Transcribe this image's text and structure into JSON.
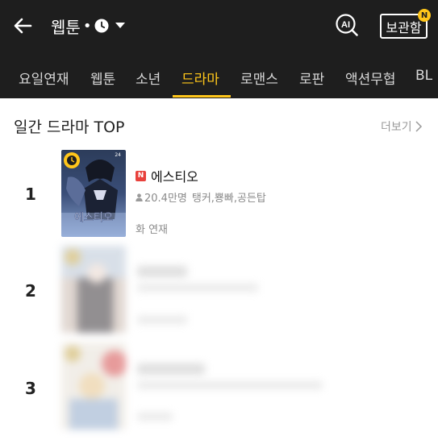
{
  "header": {
    "title": "웹툰",
    "separator": "•",
    "box_label": "보관함",
    "box_badge": "N",
    "ai_label": "AI"
  },
  "tabs": [
    {
      "label": "요일연재",
      "active": false
    },
    {
      "label": "웹툰",
      "active": false
    },
    {
      "label": "소년",
      "active": false
    },
    {
      "label": "드라마",
      "active": true
    },
    {
      "label": "로맨스",
      "active": false
    },
    {
      "label": "로판",
      "active": false
    },
    {
      "label": "액션무협",
      "active": false
    },
    {
      "label": "BL",
      "active": false
    }
  ],
  "section": {
    "title": "일간 드라마 TOP",
    "more_label": "더보기"
  },
  "rankings": [
    {
      "rank": "1",
      "title": "에스티오",
      "badge": "N",
      "views": "20.4만명",
      "authors": "탱커,뿅빠,공든탑",
      "schedule": "화 연재"
    },
    {
      "rank": "2",
      "title": "",
      "views": "",
      "authors": "",
      "schedule": ""
    },
    {
      "rank": "3",
      "title": "",
      "views": "",
      "authors": "",
      "schedule": ""
    }
  ],
  "colors": {
    "accent": "#ffc61a",
    "header_bg": "#1e1e1e",
    "new_badge": "#e8413c"
  }
}
